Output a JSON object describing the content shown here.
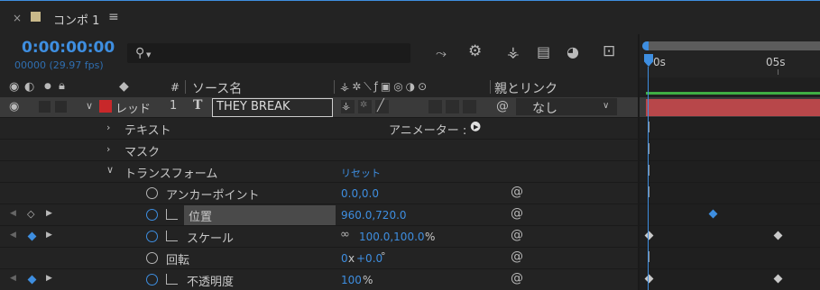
{
  "tab": {
    "title": "コンポ 1"
  },
  "time": {
    "timecode": "0:00:00:00",
    "frames_fps": "00000 (29.97 fps)"
  },
  "columns": {
    "num": "#",
    "source_name": "ソース名",
    "parent_link": "親とリンク"
  },
  "ruler": {
    "label_0": "0s",
    "label_5": "05s"
  },
  "layer": {
    "label": "レッド",
    "number": "1",
    "name": "THEY BREAK",
    "parent": "なし",
    "color": "#c8282a"
  },
  "rows": {
    "text": "テキスト",
    "animator": "アニメーター :",
    "mask": "マスク",
    "transform": "トランスフォーム",
    "reset": "リセット",
    "anchor": {
      "label": "アンカーポイント",
      "value": "0.0,0.0"
    },
    "position": {
      "label": "位置",
      "value": "960.0,720.0"
    },
    "scale": {
      "label": "スケール",
      "value": "100.0,100.0",
      "unit": "%"
    },
    "rotation": {
      "label": "回転",
      "value_a": "0",
      "value_x": "x",
      "value_b": "+0.0",
      "unit": "°"
    },
    "opacity": {
      "label": "不透明度",
      "value": "100",
      "unit": "%"
    }
  },
  "colors": {
    "accent": "#3e8ee0",
    "layer_bar": "#b8474a"
  }
}
